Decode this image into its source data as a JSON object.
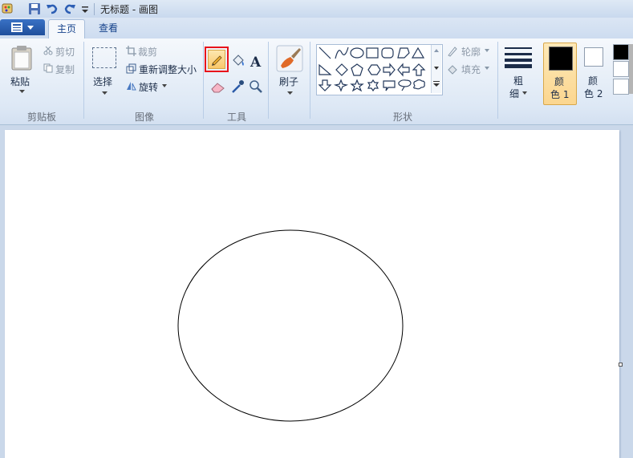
{
  "window": {
    "title": "无标题 - 画图"
  },
  "tabs": {
    "home": "主页",
    "view": "查看"
  },
  "clipboard": {
    "paste": "粘贴",
    "cut": "剪切",
    "copy": "复制",
    "group": "剪贴板"
  },
  "image": {
    "select": "选择",
    "crop": "裁剪",
    "resize": "重新调整大小",
    "rotate": "旋转",
    "group": "图像"
  },
  "tools": {
    "group": "工具"
  },
  "brushes": {
    "label": "刷子"
  },
  "shapes": {
    "outline": "轮廓",
    "fill": "填充",
    "group": "形状"
  },
  "size": {
    "label_line1": "粗",
    "label_line2": "细"
  },
  "colors": {
    "color1_line1": "颜",
    "color1_line2": "色 1",
    "color2_line1": "颜",
    "color2_line2": "色 2",
    "color1_value": "#000000",
    "color2_value": "#ffffff",
    "highlight": "#fbd68f",
    "pencil_highlight": "#e8131b"
  }
}
